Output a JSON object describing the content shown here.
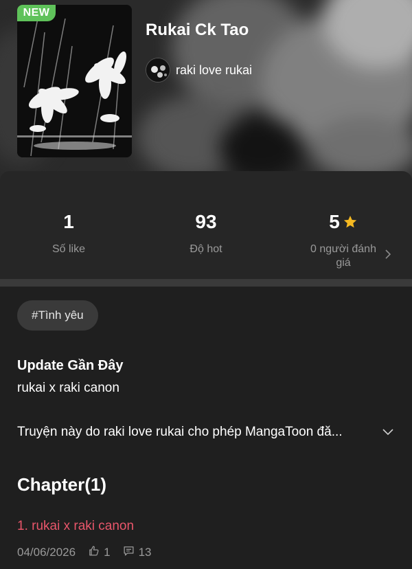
{
  "header": {
    "badge": "NEW",
    "title": "Rukai Ck Tao",
    "author": "raki love rukai"
  },
  "stats": {
    "likes": {
      "value": "1",
      "label": "Số like"
    },
    "hot": {
      "value": "93",
      "label": "Độ hot"
    },
    "rating": {
      "value": "5",
      "label_line1": "0 người đánh",
      "label_line2": "giá"
    }
  },
  "tags": [
    "#Tình yêu"
  ],
  "update": {
    "heading": "Update Gần Đây",
    "text": "rukai x raki canon"
  },
  "description": "Truyện này do raki love rukai cho phép MangaToon đă...",
  "chapters": {
    "heading": "Chapter(1)",
    "items": [
      {
        "title": "1. rukai x raki canon",
        "date": "04/06/2026",
        "likes": "1",
        "comments": "13"
      }
    ]
  },
  "colors": {
    "background": "#1f1f1f",
    "card": "#262626",
    "badge": "#5fc25a",
    "chapter_link": "#e9566b",
    "star": "#f5b921"
  }
}
